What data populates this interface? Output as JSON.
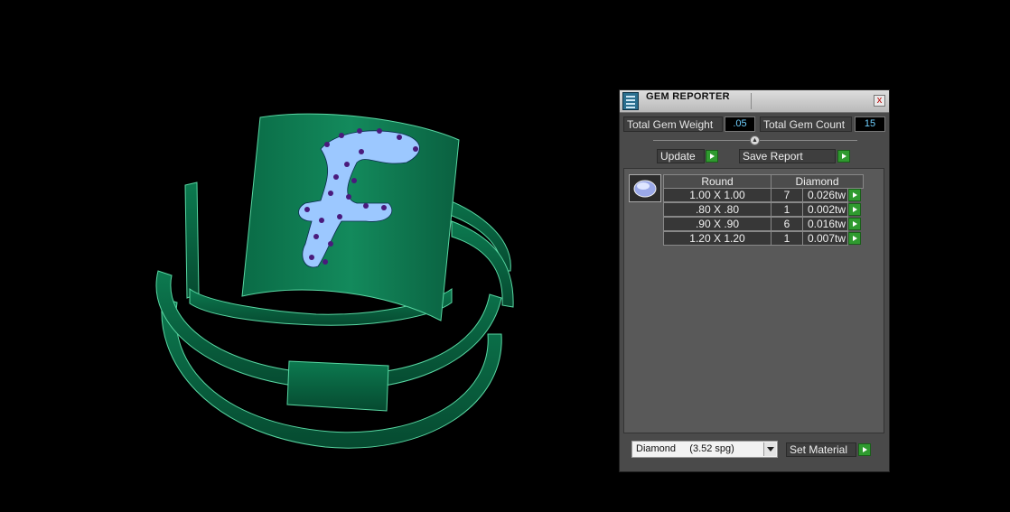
{
  "viewport": {
    "model": "ring-with-letter-f",
    "colors": {
      "metal": "#0e7a52",
      "metal_dark": "#06553a",
      "edge": "#58d6a2",
      "gem": "#9cc8ff",
      "prong": "#4a1a7c"
    }
  },
  "panel": {
    "title": "GEM REPORTER",
    "close_glyph": "x",
    "total_gem_weight_label": "Total Gem Weight",
    "total_gem_weight_value": ".05",
    "total_gem_count_label": "Total Gem Count",
    "total_gem_count_value": "15",
    "update_label": "Update",
    "save_report_label": "Save Report",
    "table": {
      "headers": [
        "Round",
        "Diamond"
      ],
      "rows": [
        {
          "size": "1.00 X 1.00",
          "count": "7",
          "weight": "0.026tw"
        },
        {
          "size": ".80 X .80",
          "count": "1",
          "weight": "0.002tw"
        },
        {
          "size": ".90 X .90",
          "count": "6",
          "weight": "0.016tw"
        },
        {
          "size": "1.20 X 1.20",
          "count": "1",
          "weight": "0.007tw"
        }
      ]
    },
    "material_value": "Diamond     (3.52 spg)",
    "set_material_label": "Set Material",
    "colors": {
      "panel_bg": "#4a4a4a",
      "value_text": "#6fd0ff",
      "go_button": "#2f9a2f"
    }
  }
}
